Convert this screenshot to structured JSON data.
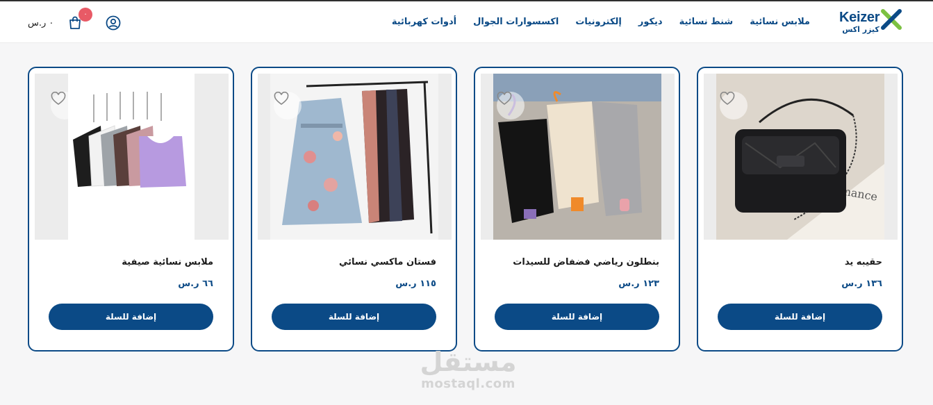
{
  "header": {
    "logo_text": "Keizer",
    "logo_text_ar": "كيزر اكس",
    "nav": [
      "أدوات كهربائية",
      "اكسسوارات الجوال",
      "إلكترونيات",
      "ديكور",
      "شنط نسائية",
      "ملابس نسائية"
    ],
    "cart_count": "٠",
    "cart_total": "٠ ر.س"
  },
  "products": [
    {
      "name": "حقيبه يد",
      "price": "١٣٦ ر.س",
      "button": "إضافة للسلة"
    },
    {
      "name": "بنطلون رياضي فضفاض للسيدات",
      "price": "١٢٣ ر.س",
      "button": "إضافة للسلة"
    },
    {
      "name": "فستان ماكسي نسائي",
      "price": "١١٥ ر.س",
      "button": "إضافة للسلة"
    },
    {
      "name": "ملابس نسائية صيفية",
      "price": "٦٦ ر.س",
      "button": "إضافة للسلة"
    }
  ],
  "watermark": {
    "ar": "مستقل",
    "latin": "mostaql.com"
  },
  "colors": {
    "brand": "#0b4a86",
    "accent_green": "#7cc142",
    "badge": "#e85a66"
  }
}
